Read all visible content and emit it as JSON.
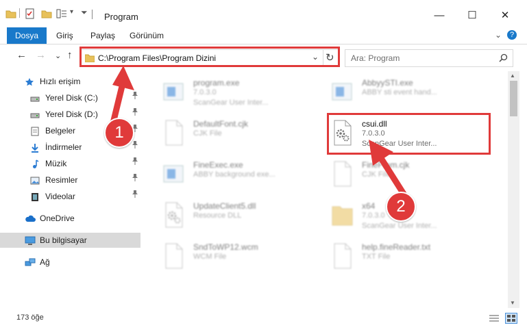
{
  "window": {
    "title": "Program",
    "minimize": "—",
    "maximize": "☐",
    "close": "✕"
  },
  "ribbon": {
    "file_tab": "Dosya",
    "tabs": [
      "Giriş",
      "Paylaş",
      "Görünüm"
    ],
    "expand": "⌄",
    "help": "?"
  },
  "nav": {
    "back": "←",
    "forward": "→",
    "recent": "⌄",
    "up": "↑",
    "address": "C:\\Program Files\\Program Dizini",
    "dropdown": "⌄",
    "refresh": "↻",
    "search_placeholder": "Ara: Program",
    "search_icon": "⚲"
  },
  "sidebar": {
    "items": [
      {
        "label": "Hızlı erişim",
        "icon": "star-icon",
        "pinned": false
      },
      {
        "label": "Yerel Disk (C:)",
        "icon": "drive-icon",
        "pinned": true
      },
      {
        "label": "Yerel Disk (D:)",
        "icon": "drive-icon",
        "pinned": true
      },
      {
        "label": "Belgeler",
        "icon": "document-icon",
        "pinned": true
      },
      {
        "label": "İndirmeler",
        "icon": "download-icon",
        "pinned": true
      },
      {
        "label": "Müzik",
        "icon": "music-icon",
        "pinned": true
      },
      {
        "label": "Resimler",
        "icon": "pictures-icon",
        "pinned": true
      },
      {
        "label": "Videolar",
        "icon": "video-icon",
        "pinned": true
      },
      {
        "label": "OneDrive",
        "icon": "cloud-icon",
        "pinned": false
      },
      {
        "label": "Bu bilgisayar",
        "icon": "computer-icon",
        "pinned": false
      },
      {
        "label": "Ağ",
        "icon": "network-icon",
        "pinned": false
      }
    ],
    "pin_glyph": "📌"
  },
  "files": [
    {
      "name": "program.exe",
      "line1": "7.0.3.0",
      "line2": "ScanGear User Inter...",
      "icon": "exe-icon"
    },
    {
      "name": "AbbyySTI.exe",
      "line1": "ABBY sti event hand...",
      "line2": "",
      "icon": "exe-icon"
    },
    {
      "name": "DefaultFont.cjk",
      "line1": "CJK File",
      "line2": "",
      "icon": "file-icon"
    },
    {
      "name": "csui.dll",
      "line1": "7.0.3.0",
      "line2": "ScanGear User Inter...",
      "icon": "dll-icon"
    },
    {
      "name": "FineExec.exe",
      "line1": "ABBY background exe...",
      "line2": "",
      "icon": "exe-icon"
    },
    {
      "name": "FineFrom.cjk",
      "line1": "CJK File",
      "line2": "",
      "icon": "file-icon"
    },
    {
      "name": "UpdateClient5.dll",
      "line1": "Resource DLL",
      "line2": "",
      "icon": "dll-icon"
    },
    {
      "name": "x64",
      "line1": "7.0.3.0",
      "line2": "ScanGear User Inter...",
      "icon": "folder-icon"
    },
    {
      "name": "SndToWP12.wcm",
      "line1": "WCM File",
      "line2": "",
      "icon": "file-icon"
    },
    {
      "name": "help.fineReader.txt",
      "line1": "TXT File",
      "line2": "",
      "icon": "file-icon"
    }
  ],
  "status": {
    "count": "173 öğe"
  },
  "annotations": {
    "step1": "1",
    "step2": "2"
  },
  "colors": {
    "accent": "#1979ca",
    "highlight": "#e03a3a"
  }
}
